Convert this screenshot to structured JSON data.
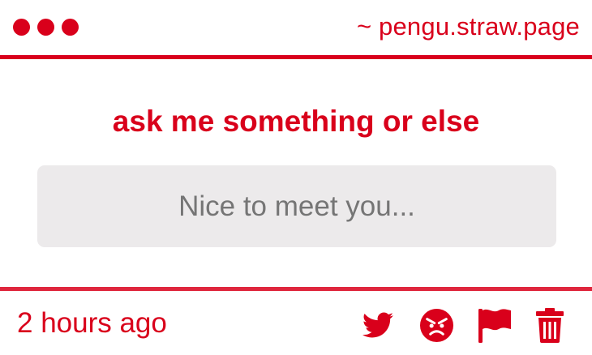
{
  "header": {
    "site_url": "~ pengu.straw.page"
  },
  "main": {
    "prompt": "ask me something or else",
    "input_placeholder": "Nice to meet you..."
  },
  "footer": {
    "timestamp": "2 hours ago",
    "actions": [
      {
        "name": "twitter-share",
        "icon": "twitter-icon"
      },
      {
        "name": "angry-reaction",
        "icon": "angry-face-icon"
      },
      {
        "name": "report",
        "icon": "flag-icon"
      },
      {
        "name": "delete",
        "icon": "trash-icon"
      }
    ]
  },
  "colors": {
    "accent": "#d9001b",
    "input_background": "#eceaeb",
    "page_background": "#ffffff"
  }
}
